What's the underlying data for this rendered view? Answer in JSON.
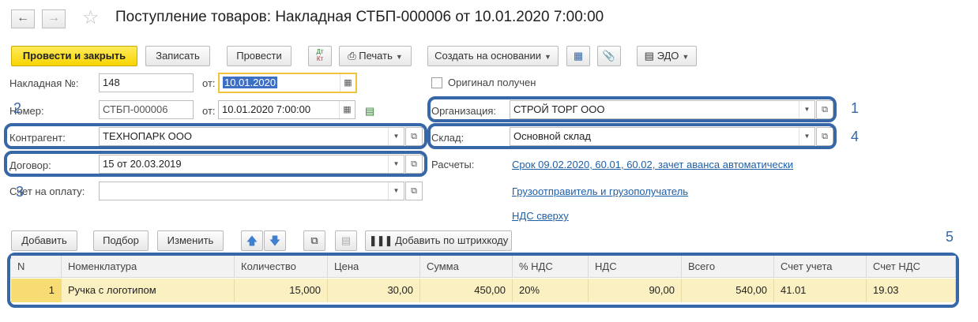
{
  "window": {
    "title": "Поступление товаров: Накладная СТБП-000006 от 10.01.2020 7:00:00"
  },
  "toolbar": {
    "post_close": "Провести и закрыть",
    "save": "Записать",
    "post": "Провести",
    "dtkt_top": "Дт",
    "dtkt_bottom": "Кт",
    "print": "Печать",
    "create_based": "Создать на основании",
    "edo": "ЭДО"
  },
  "form": {
    "invoice_label": "Накладная №:",
    "invoice_number": "148",
    "from_label": "от:",
    "invoice_date": "10.01.2020",
    "original_label": "Оригинал получен",
    "number_label": "Номер:",
    "number_value": "СТБП-000006",
    "number_date": "10.01.2020  7:00:00",
    "organization_label": "Организация:",
    "organization_value": "СТРОЙ ТОРГ ООО",
    "counterparty_label": "Контрагент:",
    "counterparty_value": "ТЕХНОПАРК ООО",
    "warehouse_label": "Склад:",
    "warehouse_value": "Основной склад",
    "contract_label": "Договор:",
    "contract_value": "15 от 20.03.2019",
    "payments_label": "Расчеты:",
    "payments_link": "Срок 09.02.2020, 60.01, 60.02, зачет аванса автоматически",
    "invoice_pay_label": "Счет на оплату:",
    "invoice_pay_value": "",
    "shipper_link": "Грузоотправитель и грузополучатель",
    "vat_link": "НДС сверху"
  },
  "annotations": [
    "1",
    "2",
    "3",
    "4",
    "5"
  ],
  "table_toolbar": {
    "add": "Добавить",
    "pick": "Подбор",
    "edit": "Изменить",
    "barcode": "Добавить по штрихкоду"
  },
  "table": {
    "columns": [
      "N",
      "Номенклатура",
      "Количество",
      "Цена",
      "Сумма",
      "% НДС",
      "НДС",
      "Всего",
      "Счет учета",
      "Счет НДС"
    ],
    "rows": [
      [
        "1",
        "Ручка с логотипом",
        "15,000",
        "30,00",
        "450,00",
        "20%",
        "90,00",
        "540,00",
        "41.01",
        "19.03"
      ]
    ]
  },
  "colors": {
    "accent_yellow": "#f8d400",
    "annotation_blue": "#3767a6",
    "link_blue": "#1f5fa8",
    "row_selected": "#fbf0c2"
  }
}
